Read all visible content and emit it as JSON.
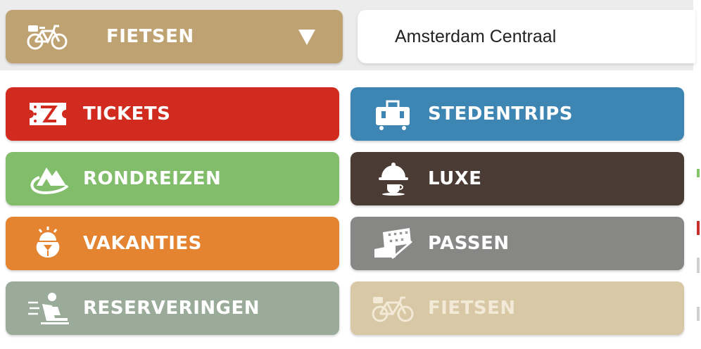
{
  "selector": {
    "label": "FIETSEN",
    "icon": "bicycle-basket-icon",
    "color": "#bfa271"
  },
  "location": {
    "value": "Amsterdam Centraal"
  },
  "menu": {
    "items": [
      {
        "label": "TICKETS",
        "icon": "ticket-icon",
        "color": "#d12b1f"
      },
      {
        "label": "STEDENTRIPS",
        "icon": "luggage-city-icon",
        "color": "#3d86b3"
      },
      {
        "label": "RONDREIZEN",
        "icon": "mountain-tour-icon",
        "color": "#82bd6c"
      },
      {
        "label": "LUXE",
        "icon": "cloche-icon",
        "color": "#4a3c35"
      },
      {
        "label": "VAKANTIES",
        "icon": "sun-drink-icon",
        "color": "#e48330"
      },
      {
        "label": "PASSEN",
        "icon": "pass-card-icon",
        "color": "#878786"
      },
      {
        "label": "RESERVERINGEN",
        "icon": "reserved-seat-icon",
        "color": "#9aab9a"
      },
      {
        "label": "FIETSEN",
        "icon": "bicycle-basket-icon",
        "color": "#d8c8a6",
        "state": "selected"
      }
    ]
  }
}
